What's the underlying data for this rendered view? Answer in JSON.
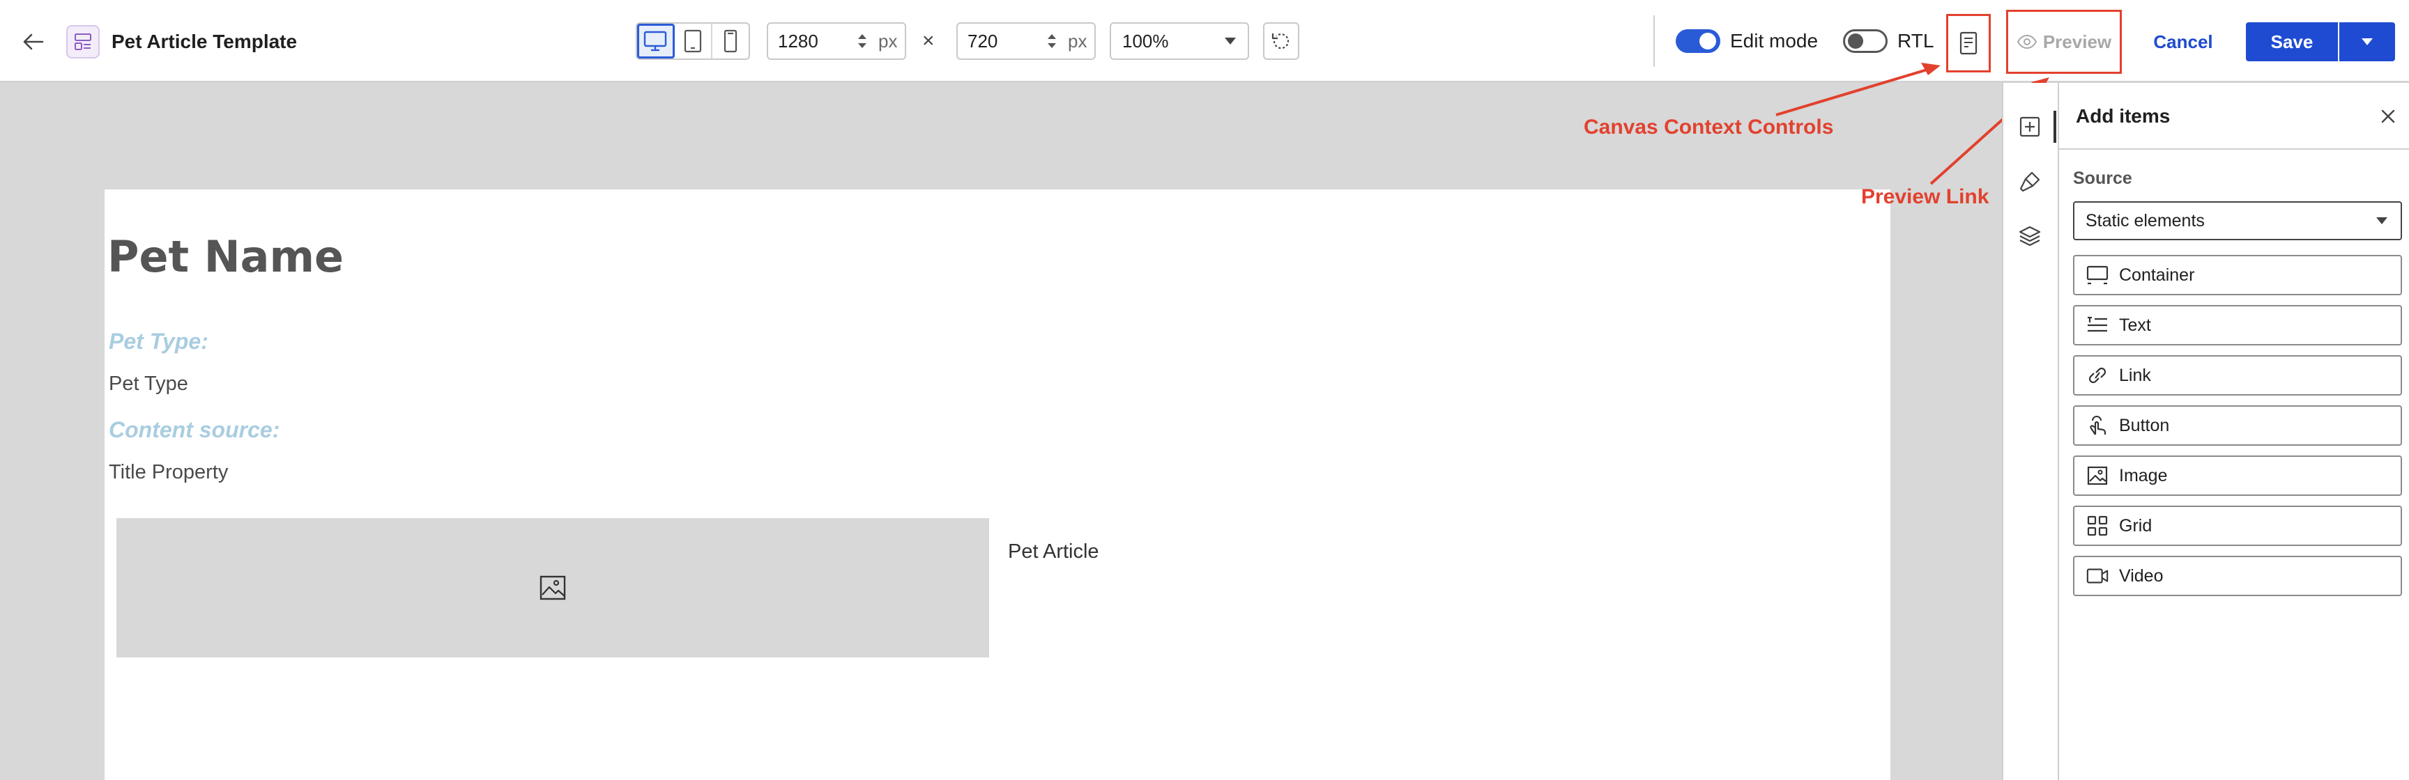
{
  "header": {
    "title": "Pet Article Template",
    "width_value": "1280",
    "height_value": "720",
    "unit": "px",
    "times": "×",
    "zoom": "100%",
    "edit_mode_label": "Edit mode",
    "edit_mode_on": true,
    "rtl_label": "RTL",
    "rtl_on": false,
    "preview_label": "Preview",
    "cancel_label": "Cancel",
    "save_label": "Save"
  },
  "canvas": {
    "pet_name": "Pet Name",
    "pet_type_label": "Pet Type:",
    "pet_type_value": "Pet Type",
    "content_source_label": "Content source:",
    "content_source_value": "Title Property",
    "pet_article": "Pet Article"
  },
  "annotations": {
    "canvas_context_controls": "Canvas Context Controls",
    "preview_link": "Preview Link"
  },
  "panel": {
    "title": "Add items",
    "source_label": "Source",
    "source_value": "Static elements",
    "items": [
      {
        "label": "Container",
        "icon": "container-icon"
      },
      {
        "label": "Text",
        "icon": "text-icon"
      },
      {
        "label": "Link",
        "icon": "link-icon"
      },
      {
        "label": "Button",
        "icon": "button-icon"
      },
      {
        "label": "Image",
        "icon": "image-icon"
      },
      {
        "label": "Grid",
        "icon": "grid-icon"
      },
      {
        "label": "Video",
        "icon": "video-icon"
      }
    ]
  },
  "colors": {
    "accent": "#1f4bd2",
    "annotation": "#e2412e",
    "label_blue": "#a9cde0",
    "canvas_bg": "#d8d8d8"
  }
}
